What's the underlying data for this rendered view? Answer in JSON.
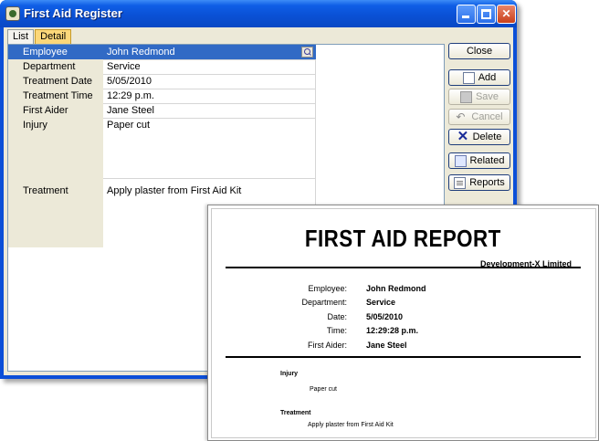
{
  "window": {
    "title": "First Aid Register",
    "tabs": [
      {
        "label": "List",
        "active": false
      },
      {
        "label": "Detail",
        "active": true
      }
    ]
  },
  "form": {
    "fields": [
      {
        "label": "Employee",
        "value": "John Redmond",
        "selected": true
      },
      {
        "label": "Department",
        "value": "Service"
      },
      {
        "label": "Treatment Date",
        "value": "5/05/2010"
      },
      {
        "label": "Treatment Time",
        "value": "12:29 p.m."
      },
      {
        "label": "First Aider",
        "value": "Jane Steel"
      },
      {
        "label": "Injury",
        "value": "Paper cut"
      },
      {
        "label": "Treatment",
        "value": "Apply plaster from First Aid Kit"
      }
    ]
  },
  "buttons": {
    "close": "Close",
    "add": "Add",
    "save": "Save",
    "cancel": "Cancel",
    "delete": "Delete",
    "related": "Related",
    "reports": "Reports"
  },
  "report": {
    "title": "FIRST AID REPORT",
    "company": "Development-X Limited",
    "details": [
      {
        "label": "Employee:",
        "value": "John Redmond"
      },
      {
        "label": "Department:",
        "value": "Service"
      },
      {
        "label": "Date:",
        "value": "5/05/2010"
      },
      {
        "label": "Time:",
        "value": "12:29:28 p.m."
      },
      {
        "label": "First Aider:",
        "value": "Jane Steel"
      }
    ],
    "injury_heading": "Injury",
    "injury_text": "Paper cut",
    "treatment_heading": "Treatment",
    "treatment_text": "Apply plaster from First Aid Kit"
  },
  "colors": {
    "title_bar": "#0a51d6",
    "selection": "#316ac5",
    "active_tab": "#fbd77a",
    "close_button": "#c9401a"
  },
  "icons": [
    "app-icon",
    "minimize-icon",
    "maximize-icon",
    "close-icon",
    "lookup-icon",
    "add-icon",
    "save-icon",
    "cancel-icon",
    "delete-icon",
    "related-icon",
    "reports-icon"
  ]
}
